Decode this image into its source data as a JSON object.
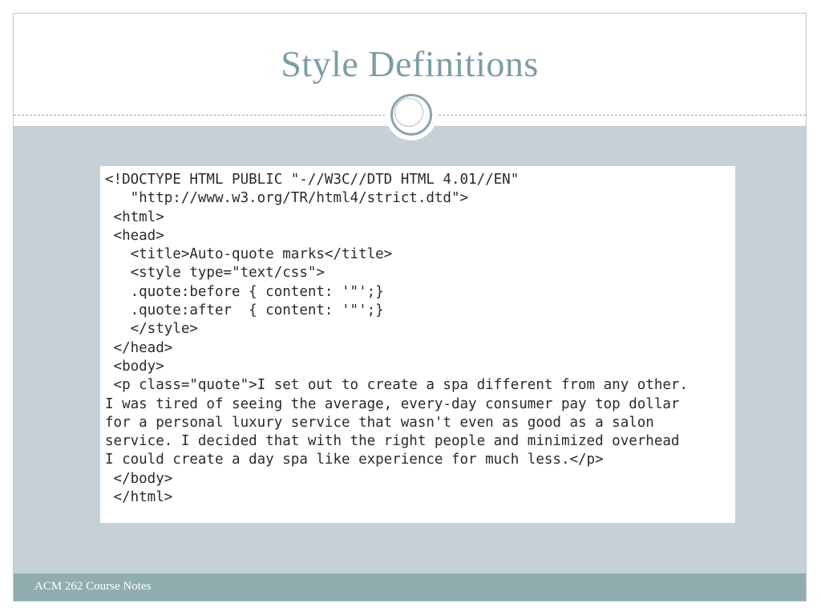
{
  "slide": {
    "title": "Style Definitions",
    "code": "<!DOCTYPE HTML PUBLIC \"-//W3C//DTD HTML 4.01//EN\"\n   \"http://www.w3.org/TR/html4/strict.dtd\">\n <html>\n <head>\n   <title>Auto-quote marks</title>\n   <style type=\"text/css\">\n   .quote:before { content: '\"';}\n   .quote:after  { content: '\"';}\n   </style>\n </head>\n <body>\n <p class=\"quote\">I set out to create a spa different from any other.\nI was tired of seeing the average, every-day consumer pay top dollar\nfor a personal luxury service that wasn't even as good as a salon\nservice. I decided that with the right people and minimized overhead\nI could create a day spa like experience for much less.</p>\n </body>\n </html>",
    "footer": "ACM 262 Course Notes"
  },
  "colors": {
    "title": "#7b9ea6",
    "background": "#c5d1d6",
    "footer": "#8fadaf",
    "ornament": "#8aa4ab"
  },
  "icons": {
    "ornament": "circle-ring-ornament"
  }
}
